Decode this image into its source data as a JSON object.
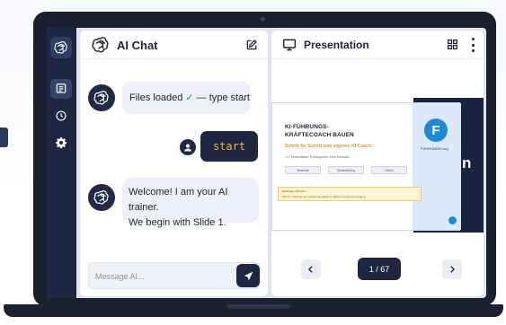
{
  "sidebar": {
    "items": [
      {
        "icon": "openai-logo-icon"
      },
      {
        "icon": "chat-icon",
        "active": true
      },
      {
        "icon": "history-icon"
      },
      {
        "icon": "gear-icon"
      }
    ]
  },
  "chat": {
    "title": "AI Chat",
    "messages": [
      {
        "role": "assistant",
        "text_before": "Files loaded ",
        "check": "✓",
        "text_after": " — type start"
      },
      {
        "role": "user",
        "text": "start"
      },
      {
        "role": "assistant",
        "line1": "Welcome! I am your AI trainer.",
        "line2": "We begin with Slide 1."
      }
    ],
    "input_value": "",
    "input_placeholder": "Message AI..."
  },
  "presentation": {
    "title": "Presentation",
    "slide": {
      "title_line1": "KI-FÜHRUNGS-",
      "title_line2": "KRÄFTECOACH BAUEN",
      "subtitle": "Schritt für Schritt zum eigenen KI-Coach",
      "meta": "74 Themenfelder, 8 Kategorien, Eine Methode",
      "chips": [
        "Verstehen",
        "Strukturierung",
        "Gefühl"
      ],
      "note_title": "Wichtiger Hinweis",
      "note_text": "Alle KI_ Wirkung und sauber Feedback im aktiven Vertrauensumgang",
      "badge_letter": "F",
      "badge_label": "FÜHRUNGKI.org",
      "overflow_char": "n"
    },
    "page_indicator": "1 / 67"
  },
  "colors": {
    "navy": "#1d2742",
    "accent_orange": "#f2b33d",
    "success": "#1f9d55",
    "brand_blue": "#1e8ad6"
  }
}
